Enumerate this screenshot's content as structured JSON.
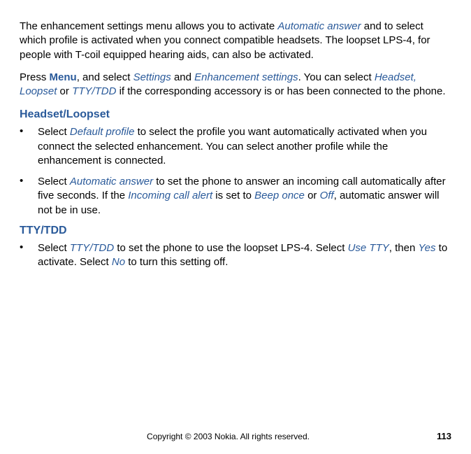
{
  "p1": {
    "a": "The enhancement settings menu allows you to activate ",
    "b": "Automatic answer",
    "c": " and to select which profile is activated when you connect compatible headsets. The loopset LPS-4,  for people with T-coil equipped hearing aids, can also be activated."
  },
  "p2": {
    "a": "Press ",
    "menu": "Menu",
    "b": ", and select ",
    "settings": "Settings",
    "c": " and ",
    "enh": "Enhancement settings",
    "d": ". You can select ",
    "hl": "Headset, Loopset",
    "e": " or ",
    "tty": "TTY/TDD",
    "f": " if the corresponding accessory is or has been connected to the phone."
  },
  "h1": "Headset/Loopset",
  "b1": {
    "a": "Select ",
    "dp": "Default profile",
    "b": " to select the profile you want automatically activated when you connect the selected enhancement.  You can select another profile while the enhancement is connected."
  },
  "b2": {
    "a": "Select ",
    "aa": "Automatic answer",
    "b": " to set the phone to answer an incoming call automatically after five seconds.  If the ",
    "ica": "Incoming call alert",
    "c": " is set to ",
    "bo": "Beep once",
    "d": " or ",
    "off": "Off",
    "e": ", automatic answer will not be in use."
  },
  "h2": "TTY/TDD",
  "b3": {
    "a": "Select ",
    "tty": "TTY/TDD",
    "b": " to set the phone to use the loopset LPS-4.  Select ",
    "ut": "Use TTY",
    "c": ", then ",
    "yes": "Yes",
    "d": " to activate.  Select ",
    "no": "No",
    "e": " to turn this setting off."
  },
  "footer": {
    "copyright": "Copyright © 2003 Nokia. All rights reserved.",
    "page": "113"
  }
}
